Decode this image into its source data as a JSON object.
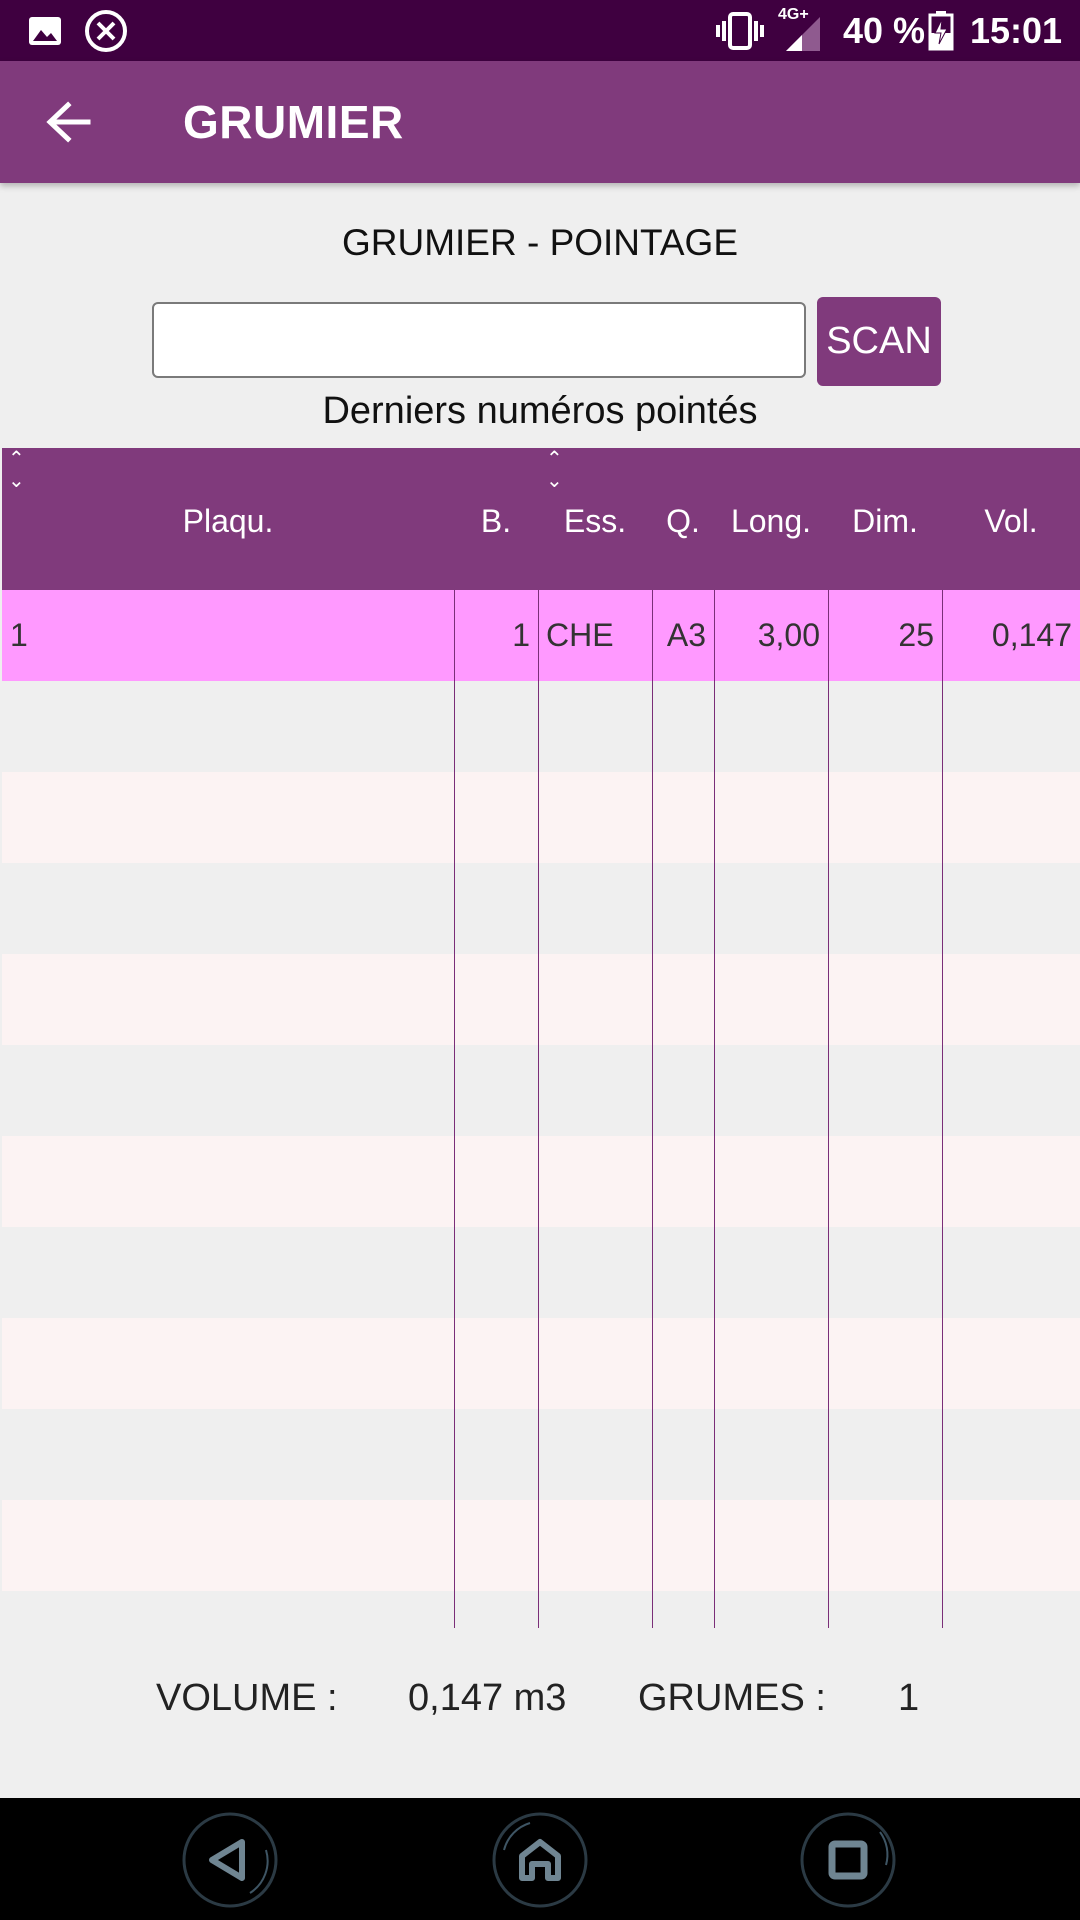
{
  "status_bar": {
    "icons": [
      "image-icon",
      "close-circle-icon",
      "vibrate-icon",
      "signal-icon",
      "battery-charging-icon"
    ],
    "network": "4G+",
    "battery": "40 %",
    "time": "15:01"
  },
  "app_bar": {
    "title": "GRUMIER",
    "back_icon": "arrow-left-icon"
  },
  "form": {
    "section_title": "GRUMIER - POINTAGE",
    "scan_input_value": "",
    "scan_button": "SCAN",
    "subtitle": "Derniers numéros pointés"
  },
  "grid": {
    "columns": [
      "Plaqu.",
      "B.",
      "Ess.",
      "Q.",
      "Long.",
      "Dim.",
      "Vol."
    ],
    "rows": [
      {
        "plaque": "1",
        "b": "1",
        "ess": "CHE",
        "q": "A3",
        "long": "3,00",
        "dim": "25",
        "vol": "0,147",
        "selected": true
      }
    ],
    "colors": {
      "header": "#803a7c",
      "selected_row": "#ff99ff",
      "row_even": "#efefef",
      "row_odd": "#fcf3f3",
      "divider": "#7a2e78"
    }
  },
  "footer": {
    "volume_label": "VOLUME :",
    "volume_value": "0,147 m3",
    "grumes_label": "GRUMES :",
    "grumes_value": "1"
  },
  "nav_bar": {
    "buttons": [
      "back-triangle-icon",
      "home-icon",
      "recent-apps-icon"
    ]
  }
}
